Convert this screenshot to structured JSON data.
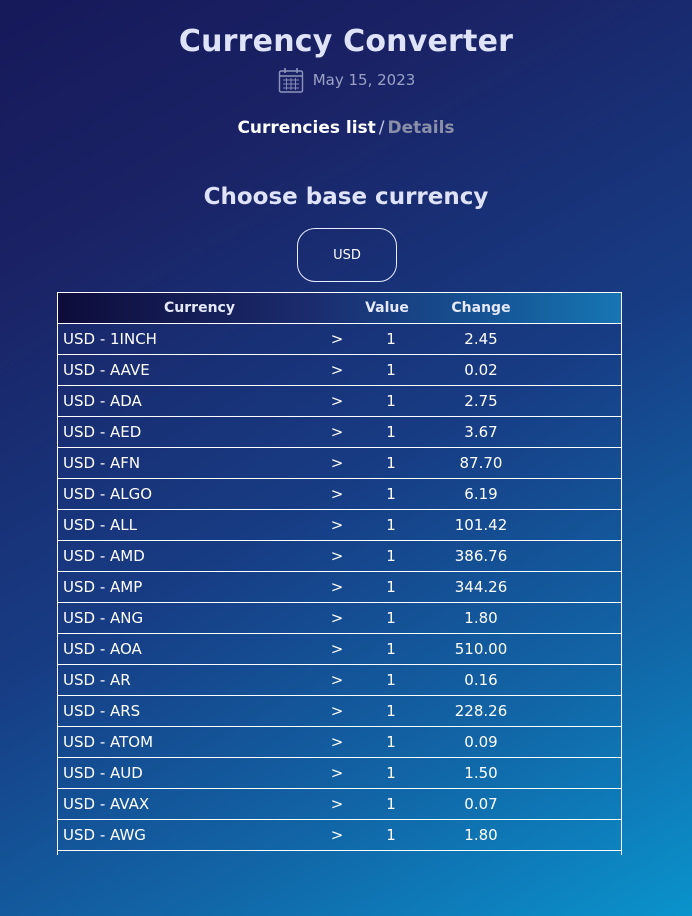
{
  "header": {
    "title": "Currency Converter",
    "date": "May 15, 2023",
    "calendar_icon": "calendar-icon"
  },
  "breadcrumb": {
    "active": "Currencies list",
    "separator": "/",
    "inactive": "Details"
  },
  "base": {
    "heading": "Choose base currency",
    "selected": "USD"
  },
  "table": {
    "columns": [
      "Currency",
      "Value",
      "Change"
    ],
    "rows": [
      {
        "currency": "USD - 1INCH",
        "arrow": ">",
        "value": "1",
        "change": "2.45"
      },
      {
        "currency": "USD - AAVE",
        "arrow": ">",
        "value": "1",
        "change": "0.02"
      },
      {
        "currency": "USD - ADA",
        "arrow": ">",
        "value": "1",
        "change": "2.75"
      },
      {
        "currency": "USD - AED",
        "arrow": ">",
        "value": "1",
        "change": "3.67"
      },
      {
        "currency": "USD - AFN",
        "arrow": ">",
        "value": "1",
        "change": "87.70"
      },
      {
        "currency": "USD - ALGO",
        "arrow": ">",
        "value": "1",
        "change": "6.19"
      },
      {
        "currency": "USD - ALL",
        "arrow": ">",
        "value": "1",
        "change": "101.42"
      },
      {
        "currency": "USD - AMD",
        "arrow": ">",
        "value": "1",
        "change": "386.76"
      },
      {
        "currency": "USD - AMP",
        "arrow": ">",
        "value": "1",
        "change": "344.26"
      },
      {
        "currency": "USD - ANG",
        "arrow": ">",
        "value": "1",
        "change": "1.80"
      },
      {
        "currency": "USD - AOA",
        "arrow": ">",
        "value": "1",
        "change": "510.00"
      },
      {
        "currency": "USD - AR",
        "arrow": ">",
        "value": "1",
        "change": "0.16"
      },
      {
        "currency": "USD - ARS",
        "arrow": ">",
        "value": "1",
        "change": "228.26"
      },
      {
        "currency": "USD - ATOM",
        "arrow": ">",
        "value": "1",
        "change": "0.09"
      },
      {
        "currency": "USD - AUD",
        "arrow": ">",
        "value": "1",
        "change": "1.50"
      },
      {
        "currency": "USD - AVAX",
        "arrow": ">",
        "value": "1",
        "change": "0.07"
      },
      {
        "currency": "USD - AWG",
        "arrow": ">",
        "value": "1",
        "change": "1.80"
      }
    ]
  }
}
